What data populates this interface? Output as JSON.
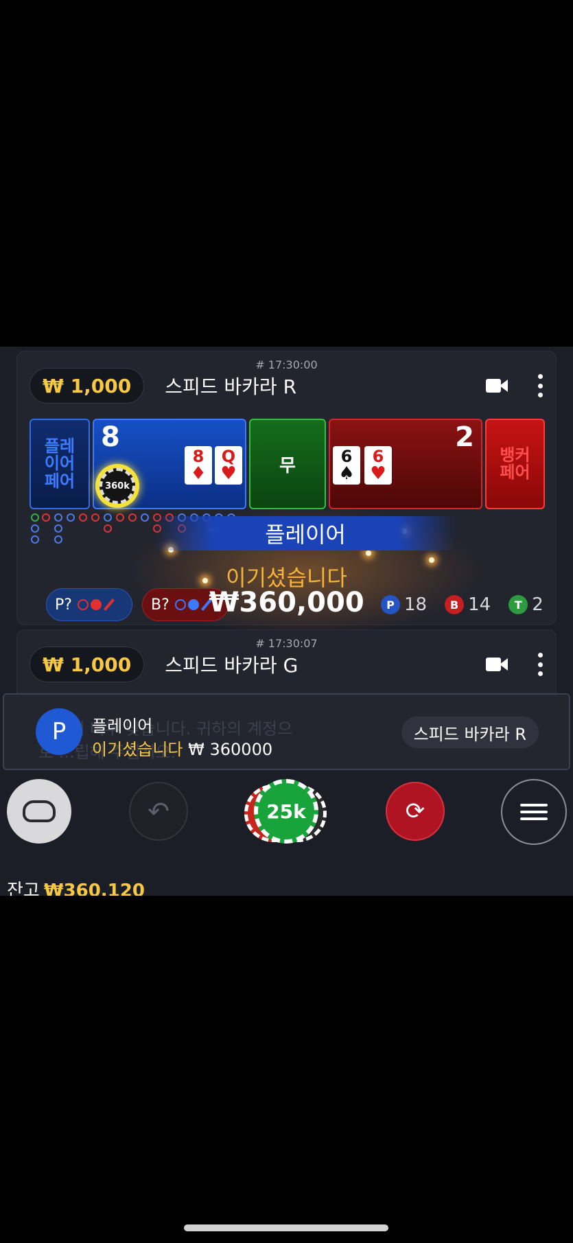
{
  "table_r": {
    "time": "# 17:30:00",
    "limit": "₩ 1,000",
    "name": "스피드 바카라 R",
    "player_pair": "플레이어페어",
    "player_score": "8",
    "player_cards": [
      {
        "rank": "8",
        "suit": "♦"
      },
      {
        "rank": "Q",
        "suit": "♥"
      }
    ],
    "tie": "무",
    "banker_cards": [
      {
        "rank": "6",
        "suit": "♠"
      },
      {
        "rank": "6",
        "suit": "♥"
      }
    ],
    "banker_score": "2",
    "banker_pair": "뱅커페어",
    "chip": "360k",
    "win_banner": "플레이어",
    "win_text": "이기셨습니다",
    "win_amount": "₩360,000",
    "pred_p": "P?",
    "pred_b": "B?",
    "stats": {
      "p_badge": "P",
      "p": "18",
      "b_badge": "B",
      "b": "14",
      "t_badge": "T",
      "t": "2"
    }
  },
  "table_g": {
    "time": "# 17:30:07",
    "limit": "₩ 1,000",
    "name": "스피드 바카라 G"
  },
  "toast": {
    "avatar": "P",
    "title": "플레이어",
    "win_label": "이기셨습니다",
    "amount": "₩ 360000",
    "table_button": "스피드 바카라 R",
    "bg_line1": "...기에 너무 낮습니다. 귀하의 계정으",
    "bg_line2": "로 ...립해 주십시오."
  },
  "bottom": {
    "chip_value": "25k",
    "undo": "↶",
    "rebet": "⟳"
  },
  "balance": {
    "label": "잔고",
    "value": "₩360,120"
  }
}
